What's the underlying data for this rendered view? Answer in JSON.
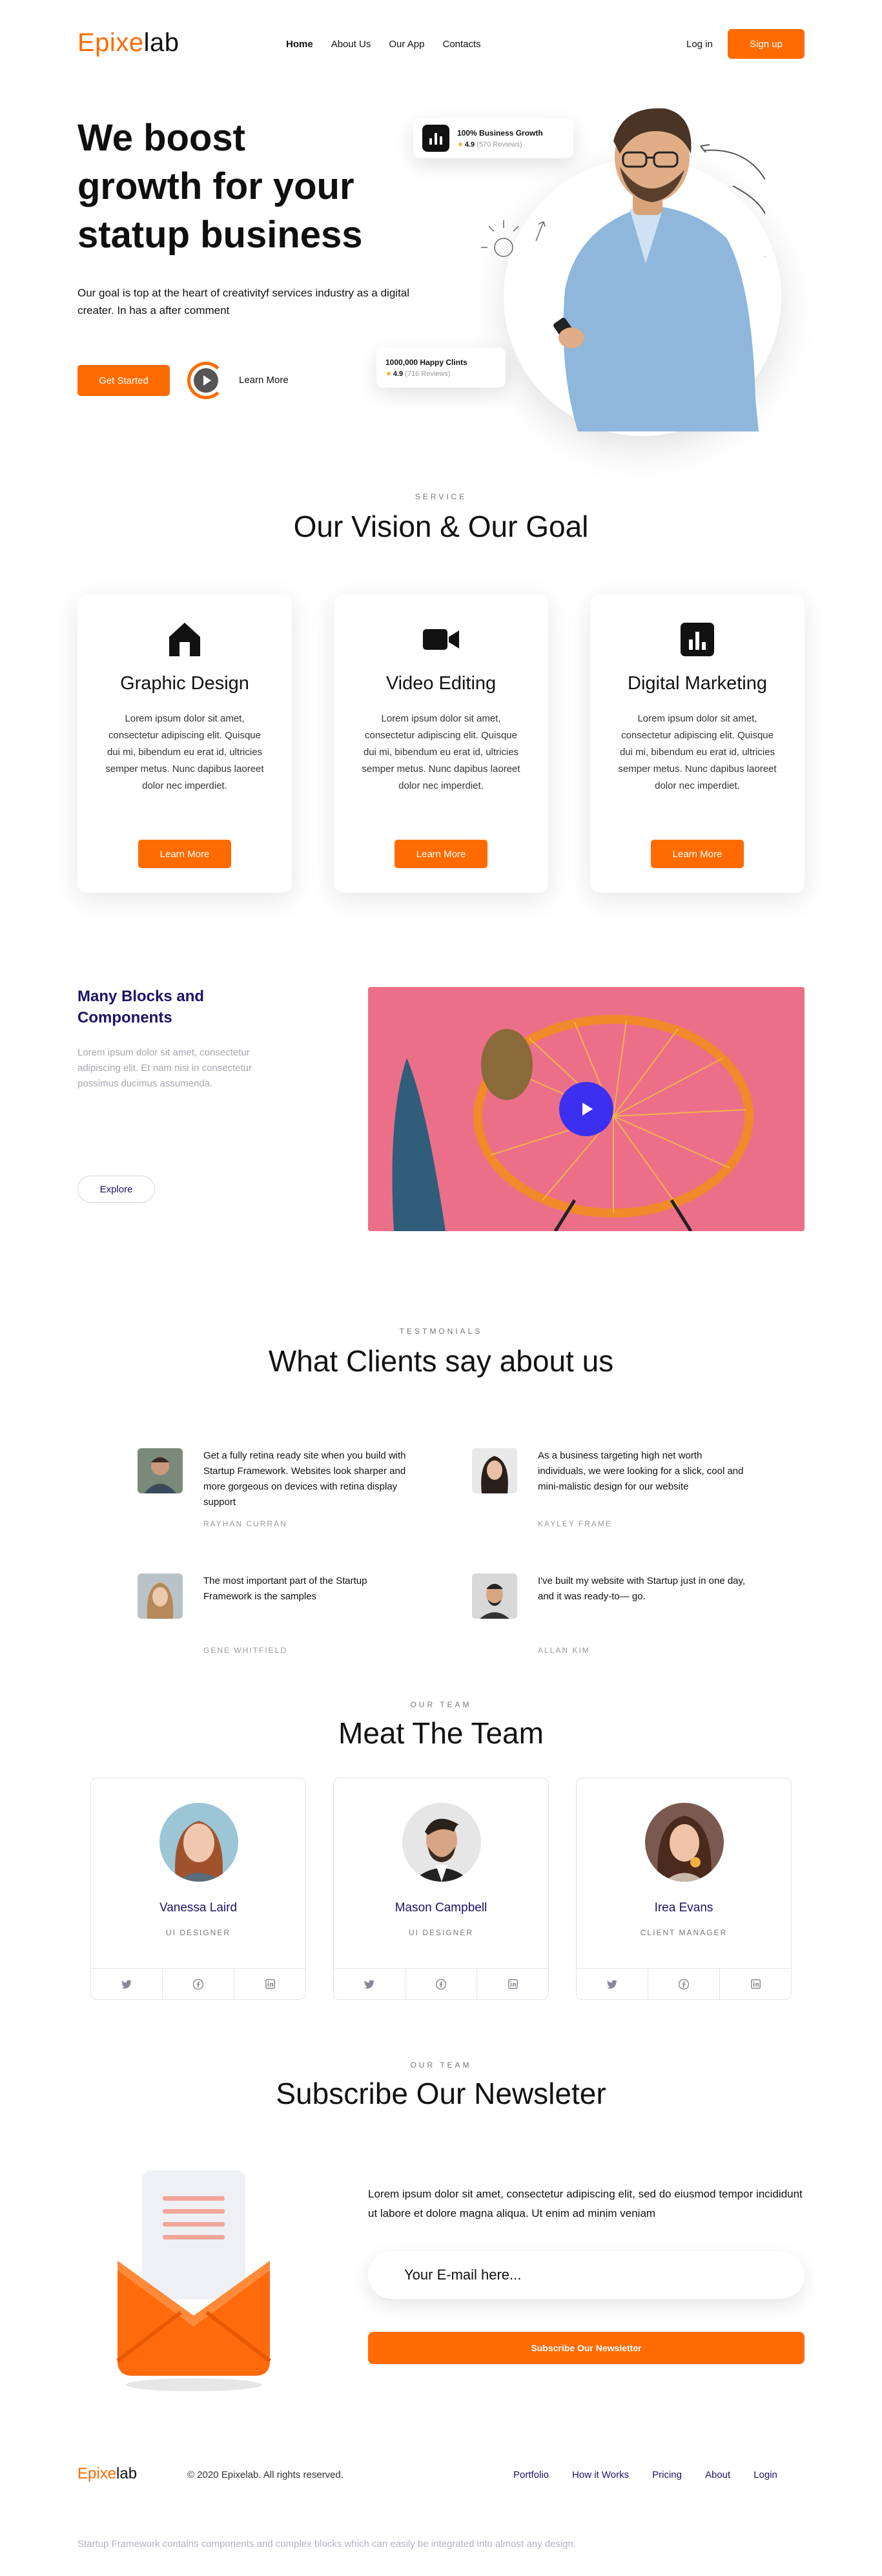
{
  "header": {
    "logo_prefix": "Epixe",
    "logo_rest": "lab",
    "nav": [
      "Home",
      "About Us",
      "Our App",
      "Contacts"
    ],
    "login": "Log in",
    "signup": "Sign up"
  },
  "hero": {
    "title_line1": "We boost",
    "title_line2": "growth for your",
    "title_line3": "statup business",
    "subtitle": "Our goal is top at the heart of creativityf services industry as a digital creater. In has a after comment",
    "cta": "Get Started",
    "learn_more": "Learn More",
    "stat1": {
      "title": "100% Business Growth",
      "rating": "4.9",
      "reviews": "(570 Reviews)"
    },
    "stat2": {
      "title": "1000,000 Happy Clints",
      "rating": "4.9",
      "reviews": "(716 Reviews)"
    }
  },
  "service": {
    "eyebrow": "SERVICE",
    "title": "Our Vision & Our Goal",
    "items": [
      {
        "icon": "home-icon",
        "title": "Graphic Design",
        "text": "Lorem ipsum dolor sit amet, consectetur adipiscing elit. Quisque dui mi, bibendum eu erat id, ultricies semper metus. Nunc dapibus laoreet dolor nec imperdiet.",
        "button": "Learn More"
      },
      {
        "icon": "video-camera-icon",
        "title": "Video Editing",
        "text": "Lorem ipsum dolor sit amet, consectetur adipiscing elit. Quisque dui mi, bibendum eu erat id, ultricies semper metus. Nunc dapibus laoreet dolor nec imperdiet.",
        "button": "Learn More"
      },
      {
        "icon": "bar-chart-icon",
        "title": "Digital Marketing",
        "text": "Lorem ipsum dolor sit amet, consectetur adipiscing elit. Quisque dui mi, bibendum eu erat id, ultricies semper metus. Nunc dapibus laoreet dolor nec imperdiet.",
        "button": "Learn More"
      }
    ]
  },
  "blocks": {
    "title": "Many Blocks and Components",
    "text": "Lorem ipsum dolor sit amet, consectetur adipiscing elit. Et nam nisi in consectetur possimus ducimus assumenda.",
    "button": "Explore"
  },
  "testimonials": {
    "eyebrow": "TESTMONIALS",
    "title": "What Clients say about us",
    "items": [
      {
        "text": "Get a fully retina ready site when you build with Startup Framework. Websites look sharper and more gorgeous on devices with retina display support",
        "name": "RAYHAN CURRAN"
      },
      {
        "text": "As a business targeting high net worth individuals, we were looking for a slick, cool and mini-malistic design for our website",
        "name": "KAYLEY FRAME"
      },
      {
        "text": "The most important part of the Startup Framework is the samples",
        "name": "GENE WHITFIELD"
      },
      {
        "text": "I've built my website with Startup just in one day, and it was ready-to— go.",
        "name": "ALLAN KIM"
      }
    ]
  },
  "team": {
    "eyebrow": "OUR TEAM",
    "title": "Meat The Team",
    "members": [
      {
        "name": "Vanessa Laird",
        "role": "UI DESIGNER"
      },
      {
        "name": "Mason Campbell",
        "role": "UI DESIGNER"
      },
      {
        "name": "Irea Evans",
        "role": "CLIENT MANAGER"
      }
    ]
  },
  "newsletter": {
    "eyebrow": "OUR TEAM",
    "title": "Subscribe Our Newsleter",
    "text": "Lorem ipsum dolor sit amet, consectetur adipiscing elit, sed do eiusmod tempor incididunt ut labore et dolore magna aliqua. Ut enim ad minim veniam",
    "input_placeholder": "Your E-mail here...",
    "button": "Subscribe Our Newsletter"
  },
  "footer": {
    "logo_prefix": "Epixe",
    "logo_rest": "lab",
    "copyright": "© 2020 Epixelab. All rights reserved.",
    "nav": [
      "Portfolio",
      "How it Works",
      "Pricing",
      "About",
      "Login"
    ],
    "note": "Startup Framework contains components and complex blocks which can easily be integrated into almost any design."
  },
  "colors": {
    "accent": "#ff6b00",
    "navy": "#1a1466",
    "play": "#3d2ff0"
  }
}
